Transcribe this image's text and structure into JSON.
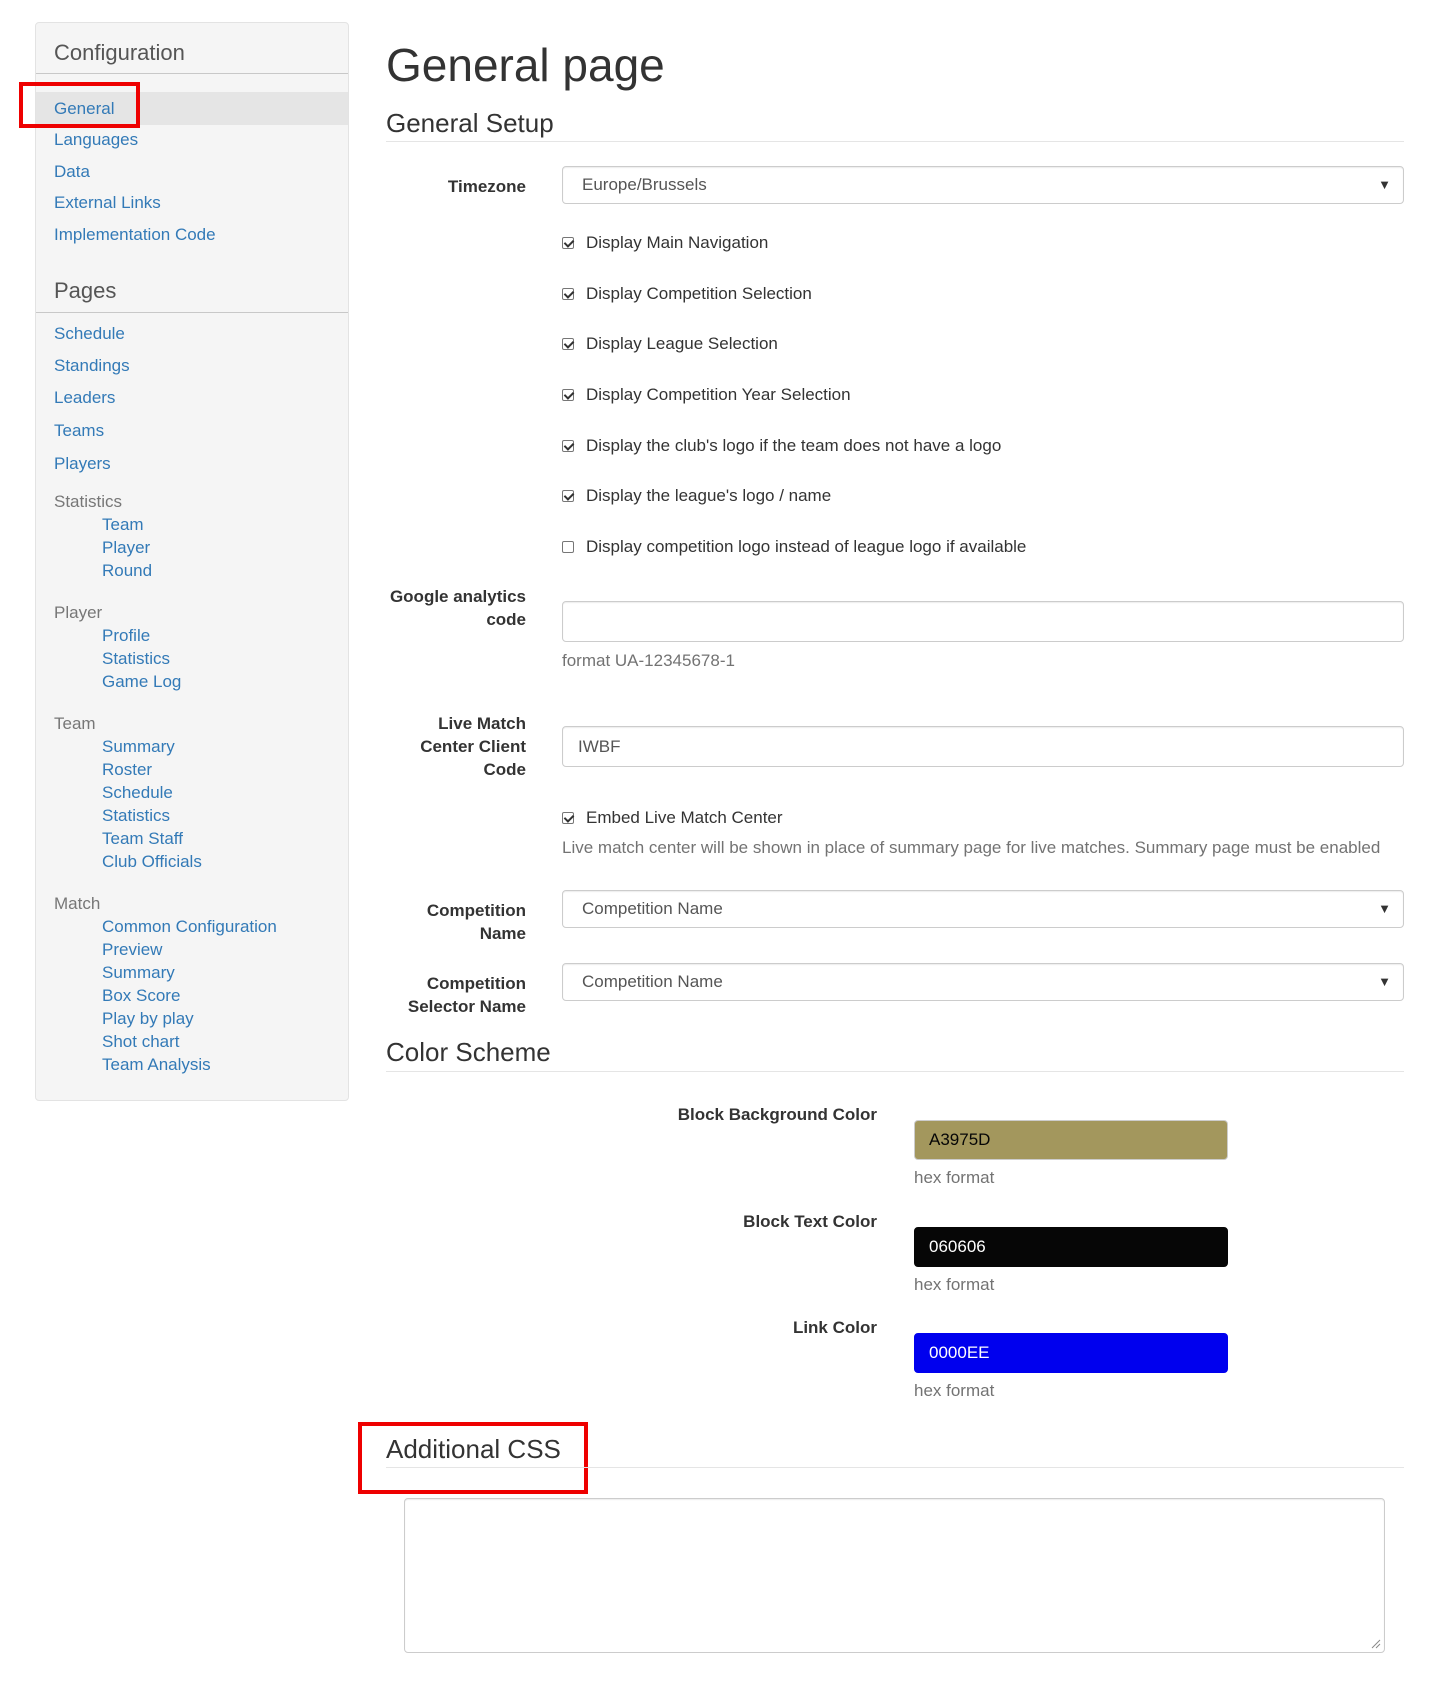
{
  "sidebar": {
    "config_heading": "Configuration",
    "config_items": [
      "General",
      "Languages",
      "Data",
      "External Links",
      "Implementation Code"
    ],
    "pages_heading": "Pages",
    "pages_items": [
      "Schedule",
      "Standings",
      "Leaders",
      "Teams",
      "Players"
    ],
    "statistics": {
      "label": "Statistics",
      "items": [
        "Team",
        "Player",
        "Round"
      ]
    },
    "player": {
      "label": "Player",
      "items": [
        "Profile",
        "Statistics",
        "Game Log"
      ]
    },
    "team": {
      "label": "Team",
      "items": [
        "Summary",
        "Roster",
        "Schedule",
        "Statistics",
        "Team Staff",
        "Club Officials"
      ]
    },
    "match": {
      "label": "Match",
      "items": [
        "Common Configuration",
        "Preview",
        "Summary",
        "Box Score",
        "Play by play",
        "Shot chart",
        "Team Analysis"
      ]
    }
  },
  "main": {
    "page_title": "General page",
    "general_setup": {
      "heading": "General Setup",
      "timezone_label": "Timezone",
      "timezone_value": "Europe/Brussels",
      "checkboxes": [
        {
          "label": "Display Main Navigation",
          "checked": true
        },
        {
          "label": "Display Competition Selection",
          "checked": true
        },
        {
          "label": "Display League Selection",
          "checked": true
        },
        {
          "label": "Display Competition Year Selection",
          "checked": true
        },
        {
          "label": "Display the club's logo if the team does not have a logo",
          "checked": true
        },
        {
          "label": "Display the league's logo / name",
          "checked": true
        },
        {
          "label": "Display competition logo instead of league logo if available",
          "checked": false
        }
      ],
      "ga_label_line1": "Google analytics",
      "ga_label_line2": "code",
      "ga_value": "",
      "ga_help": "format UA-12345678-1",
      "lmc_label_line1": "Live Match",
      "lmc_label_line2": "Center Client",
      "lmc_label_line3": "Code",
      "lmc_value": "IWBF",
      "embed_label": "Embed Live Match Center",
      "embed_checked": true,
      "embed_help": "Live match center will be shown in place of summary page for live matches. Summary page must be enabled",
      "comp_name_label_line1": "Competition",
      "comp_name_label_line2": "Name",
      "comp_name_value": "Competition Name",
      "comp_selector_label_line1": "Competition",
      "comp_selector_label_line2": "Selector Name",
      "comp_selector_value": "Competition Name"
    },
    "color_scheme": {
      "heading": "Color Scheme",
      "block_bg_label": "Block Background Color",
      "block_bg_value": "A3975D",
      "block_bg_color": "#a3975d",
      "block_text_label": "Block Text Color",
      "block_text_value": "060606",
      "block_text_color": "#060606",
      "link_label": "Link Color",
      "link_value": "0000EE",
      "link_color": "#0000ee",
      "help": "hex format"
    },
    "additional_css": {
      "heading": "Additional CSS",
      "value": ""
    }
  },
  "colors": {
    "link": "#337ab7",
    "highlight": "#ee0000"
  }
}
